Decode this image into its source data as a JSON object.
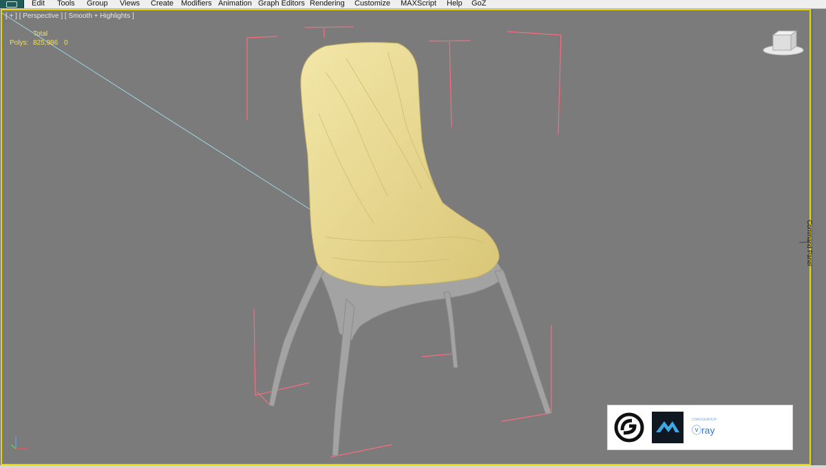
{
  "menubar": {
    "items": [
      "Edit",
      "Tools",
      "Group",
      "Views",
      "Create",
      "Modifiers",
      "Animation",
      "Graph Editors",
      "Rendering",
      "Customize",
      "MAXScript",
      "Help",
      "GoZ"
    ]
  },
  "viewport": {
    "label": "[ + ] [ Perspective ] [ Smooth + Highlights ]",
    "stats": {
      "total_label": "Total",
      "polys_label": "Polys:",
      "polys_value": "825,986",
      "polys_selected": "0"
    }
  },
  "command_panel": {
    "label": "Command Panel"
  },
  "logos": {
    "vray_small": "CHAOSGROUP",
    "vray_big": "ⓥray"
  },
  "colors": {
    "viewport_bg": "#7b7b7b",
    "active_border": "#e7d800",
    "cushion": "#eedf99",
    "frame": "#9a9a9a",
    "bounding_box": "#ff6a80",
    "stats_text": "#f1e15a"
  },
  "icons": [
    "app-menu-icon",
    "viewcube-icon",
    "axis-tripod-icon",
    "3dsmax-logo-icon",
    "zbrush-logo-icon",
    "vray-logo-icon"
  ]
}
